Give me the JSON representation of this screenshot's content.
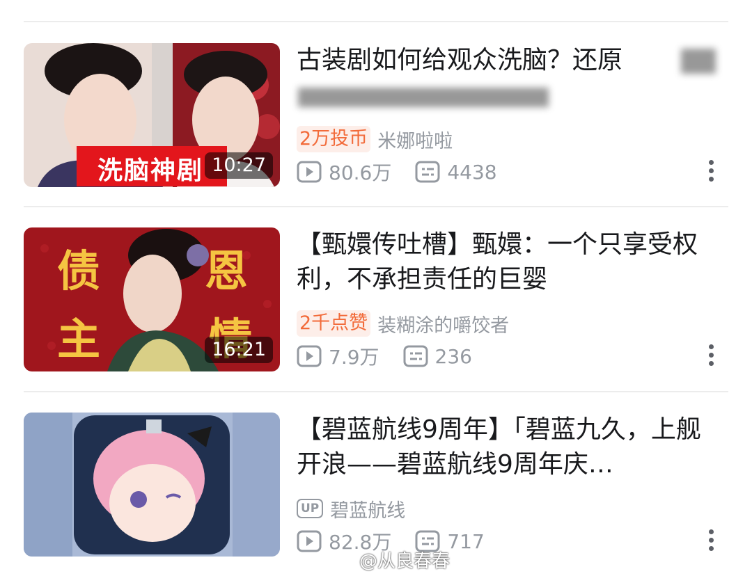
{
  "videos": [
    {
      "title": "古装剧如何给观众洗脑？还原",
      "duration": "10:27",
      "thumb_caption": "洗脑神剧",
      "badge": "2万投币",
      "author": "米娜啦啦",
      "views": "80.6万",
      "comments": "4438"
    },
    {
      "title": "【甄嬛传吐槽】甄嬛：一个只享受权利，不承担责任的巨婴",
      "duration": "16:21",
      "thumb_chars": [
        "债",
        "恩",
        "主",
        "情"
      ],
      "badge": "2千点赞",
      "author": "装糊涂的嚼饺者",
      "views": "7.9万",
      "comments": "236"
    },
    {
      "title": "【碧蓝航线9周年】「碧蓝九久，上舰开浪——碧蓝航线9周年庆…",
      "badge": "UP",
      "author": "碧蓝航线",
      "views": "82.8万",
      "comments": "717"
    }
  ],
  "watermark": "@从良春春",
  "colors": {
    "badge_text": "#f26b3a",
    "badge_bg": "#fdeee9",
    "meta_gray": "#9499a0"
  }
}
